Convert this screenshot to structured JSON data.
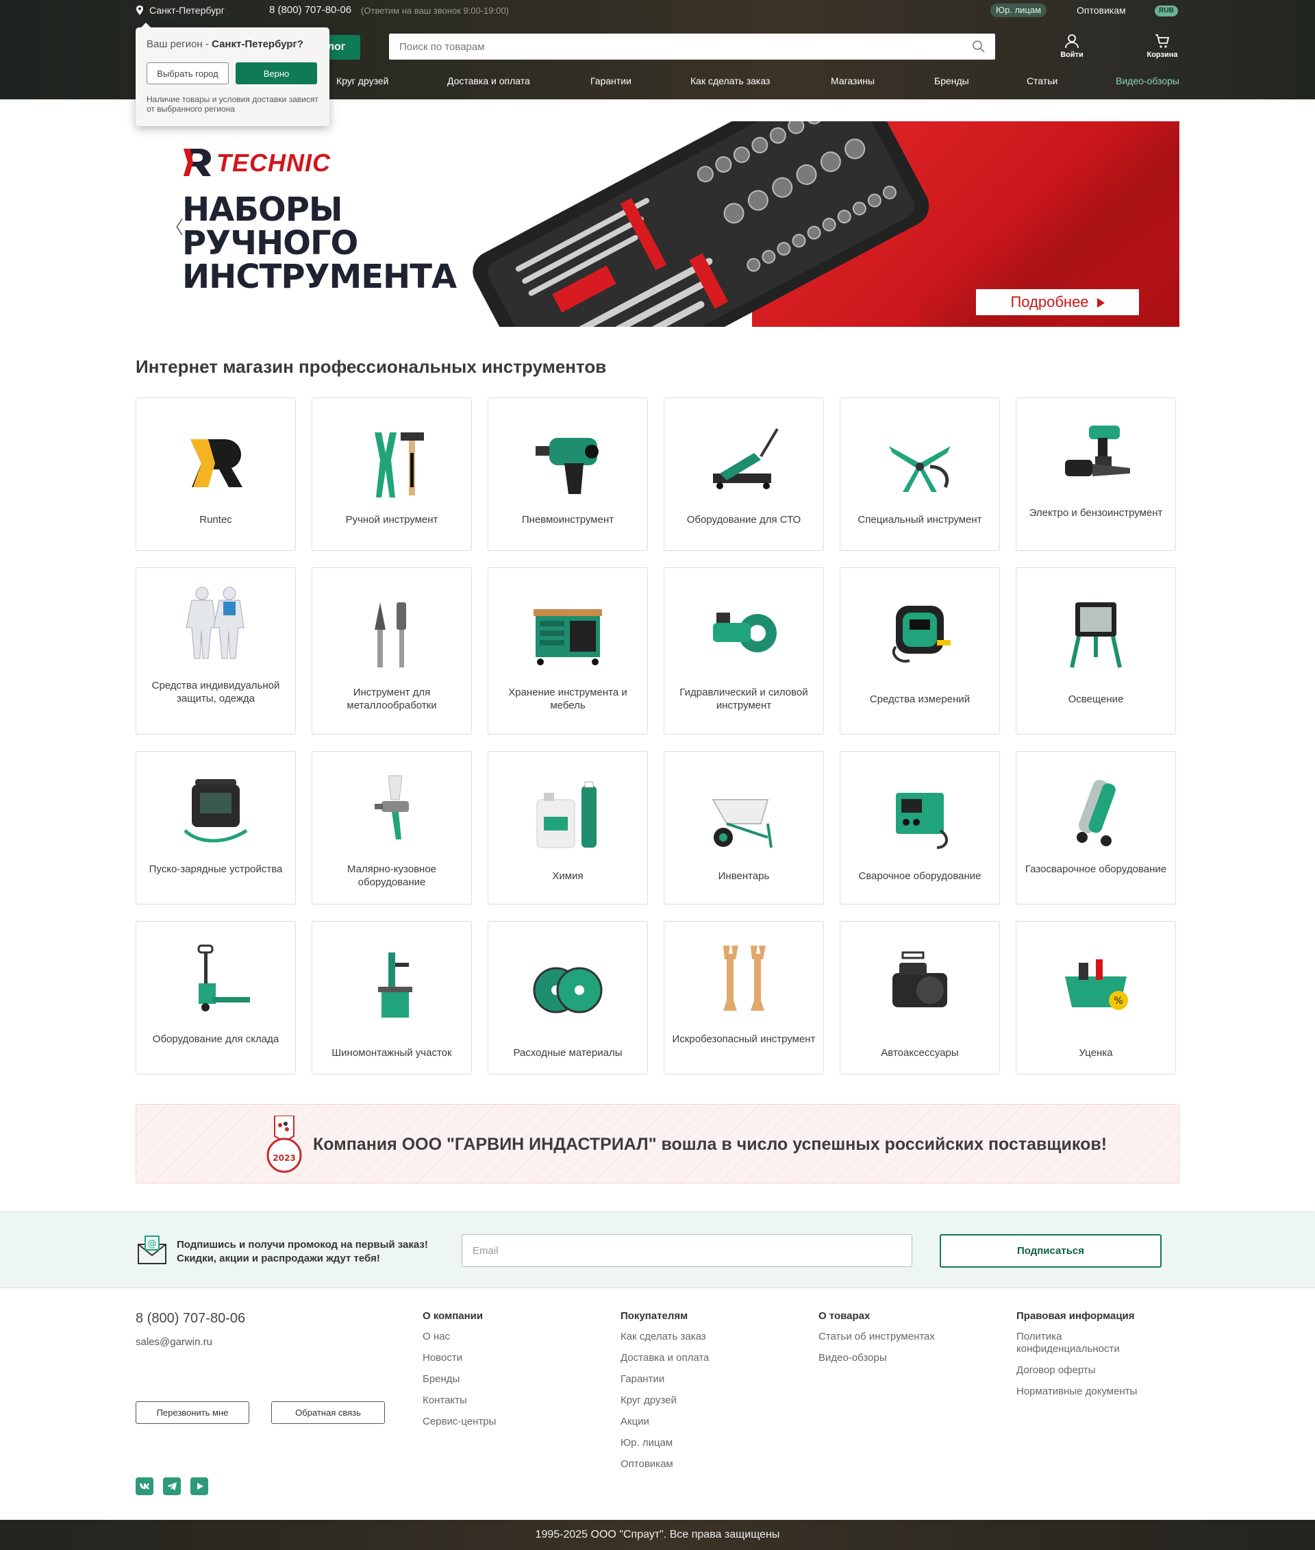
{
  "topbar": {
    "city": "Санкт-Петербург",
    "phone": "8 (800) 707-80-06",
    "phone_note": "(Ответим на ваш звонок 9:00-19:00)",
    "legal": "Юр. лицам",
    "wholesale": "Оптовикам",
    "currency": "RUB"
  },
  "header": {
    "catalog_label": "лог",
    "search_placeholder": "Поиск по товарам",
    "login_label": "Войти",
    "cart_label": "Корзина"
  },
  "region_popup": {
    "question_prefix": "Ваш регион - ",
    "question_city": "Санкт-Петербург?",
    "choose_label": "Выбрать город",
    "confirm_label": "Верно",
    "note": "Наличие товары и условия доставки зависят от выбранного региона"
  },
  "nav": [
    {
      "label": "Круг друзей"
    },
    {
      "label": "Доставка и оплата"
    },
    {
      "label": "Гарантии"
    },
    {
      "label": "Как сделать заказ"
    },
    {
      "label": "Магазины"
    },
    {
      "label": "Бренды"
    },
    {
      "label": "Статьи"
    },
    {
      "label": "Видео-обзоры"
    }
  ],
  "banner": {
    "brand": "TECHNIC",
    "title_lines": [
      "НАБОРЫ",
      "РУЧНОГО",
      "ИНСТРУМЕНТА"
    ],
    "button_label": "Подробнее",
    "prev_arrow": "〈"
  },
  "catalog": {
    "title": "Интернет магазин профессиональных инструментов",
    "items": [
      {
        "label": "Runtec",
        "icon": "runtec-logo-icon"
      },
      {
        "label": "Ручной инструмент",
        "icon": "pliers-hammer-icon"
      },
      {
        "label": "Пневмоинструмент",
        "icon": "impact-wrench-icon"
      },
      {
        "label": "Оборудование для СТО",
        "icon": "floor-jack-icon"
      },
      {
        "label": "Специальный инструмент",
        "icon": "special-pliers-icon"
      },
      {
        "label": "Электро и бензоинструмент",
        "icon": "drill-chainsaw-icon"
      },
      {
        "label": "Средства индивидуальной защиты, одежда",
        "icon": "coveralls-icon"
      },
      {
        "label": "Инструмент для металлообработки",
        "icon": "burr-bits-icon"
      },
      {
        "label": "Хранение инструмента и мебель",
        "icon": "workbench-icon"
      },
      {
        "label": "Гидравлический и силовой инструмент",
        "icon": "hydraulic-wrench-icon"
      },
      {
        "label": "Средства измерений",
        "icon": "tape-measure-icon"
      },
      {
        "label": "Освещение",
        "icon": "floodlight-icon"
      },
      {
        "label": "Пуско-зарядные устройства",
        "icon": "jump-starter-icon"
      },
      {
        "label": "Малярно-кузовное оборудование",
        "icon": "spray-gun-icon"
      },
      {
        "label": "Химия",
        "icon": "chemicals-icon"
      },
      {
        "label": "Инвентарь",
        "icon": "wheelbarrow-icon"
      },
      {
        "label": "Сварочное оборудование",
        "icon": "welder-icon"
      },
      {
        "label": "Газосварочное оборудование",
        "icon": "gas-cylinder-cart-icon"
      },
      {
        "label": "Оборудование для склада",
        "icon": "pallet-jack-icon"
      },
      {
        "label": "Шиномонтажный участок",
        "icon": "tire-changer-icon"
      },
      {
        "label": "Расходные материалы",
        "icon": "cutting-discs-icon"
      },
      {
        "label": "Искробезопасный инструмент",
        "icon": "brass-wrenches-icon"
      },
      {
        "label": "Автоаксессуары",
        "icon": "air-compressor-icon"
      },
      {
        "label": "Уценка",
        "icon": "discount-basket-icon"
      }
    ]
  },
  "supplier": {
    "text": "Компания ООО \"ГАРВИН ИНДАСТРИАЛ\" вошла в число успешных российских поставщиков!",
    "badge_year": "2023"
  },
  "subscribe": {
    "line1": "Подпишись и получи промокод на первый заказ!",
    "line2": "Скидки, акции и распродажи ждут тебя!",
    "email_placeholder": "Email",
    "button_label": "Подписаться"
  },
  "footer": {
    "phone": "8 (800) 707-80-06",
    "email": "sales@garwin.ru",
    "callback_label": "Перезвонить мне",
    "feedback_label": "Обратная связь",
    "columns": [
      {
        "title": "О компании",
        "links": [
          "О нас",
          "Новости",
          "Бренды",
          "Контакты",
          "Сервис-центры"
        ]
      },
      {
        "title": "Покупателям",
        "links": [
          "Как сделать заказ",
          "Доставка и оплата",
          "Гарантии",
          "Круг друзей",
          "Акции",
          "Юр. лицам",
          "Оптовикам"
        ]
      },
      {
        "title": "О товарах",
        "links": [
          "Статьи об инструментах",
          "Видео-обзоры"
        ]
      },
      {
        "title": "Правовая информация",
        "links": [
          "Политика конфиденциальности",
          "Договор оферты",
          "Нормативные документы"
        ]
      }
    ],
    "social": [
      "vk-icon",
      "telegram-icon",
      "youtube-icon"
    ],
    "copyright": "1995-2025 ООО \"Спраут\". Все права защищены"
  },
  "colors": {
    "accent": "#0f7a56",
    "header_dark": "#2d2c24",
    "banner_red": "#d4141b",
    "nav_active": "#8fd6b6"
  }
}
